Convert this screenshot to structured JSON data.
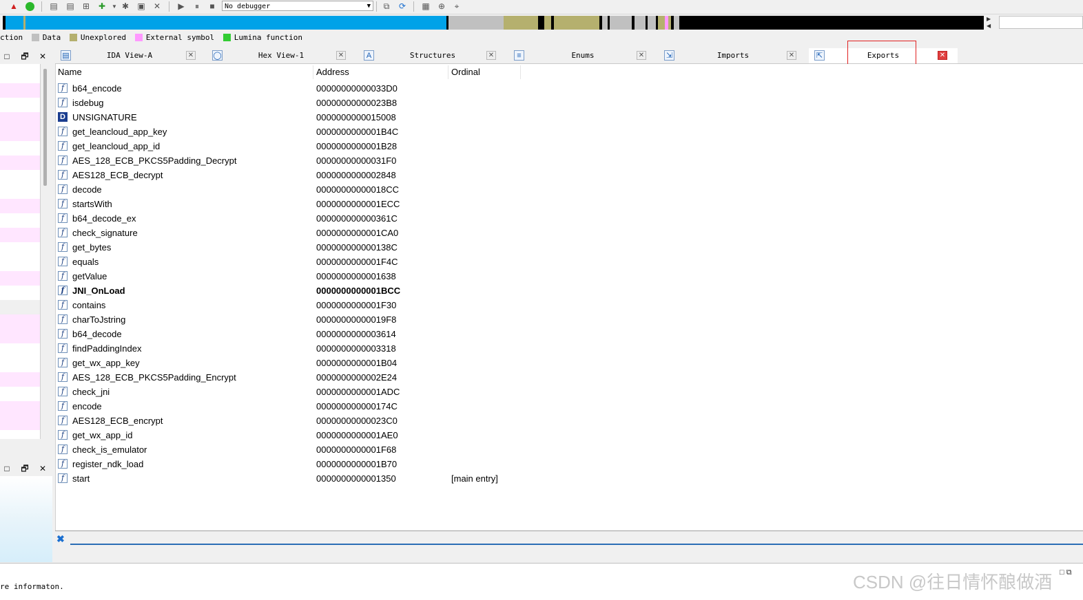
{
  "toolbar": {
    "debugger_select": "No debugger",
    "icons": [
      "warning-icon",
      "run-icon",
      "segment-icon",
      "segment2-icon",
      "add-icon",
      "plus-green-icon",
      "dropdown-icon",
      "settings-icon",
      "image-icon",
      "close-x-icon",
      "play-icon",
      "pause-icon",
      "stop-icon",
      "debug1-icon",
      "debug2-icon",
      "script-icon",
      "patch-icon",
      "cursor-icon"
    ]
  },
  "navband": {
    "colors": {
      "code": "#00a2e8",
      "data": "#c0c0c0",
      "unexplored": "#b5b06e",
      "black": "#000000",
      "external": "#ff99ff"
    }
  },
  "legend": {
    "items": [
      {
        "label": "ction",
        "color": ""
      },
      {
        "label": "Data",
        "color": "#c0c0c0"
      },
      {
        "label": "Unexplored",
        "color": "#b5b06e"
      },
      {
        "label": "External symbol",
        "color": "#ff99ff"
      },
      {
        "label": "Lumina function",
        "color": "#33cc33"
      }
    ]
  },
  "tabs": [
    {
      "label": "IDA View-A",
      "icon": "ida-view-icon"
    },
    {
      "label": "Hex View-1",
      "icon": "hex-view-icon"
    },
    {
      "label": "Structures",
      "icon": "structures-icon"
    },
    {
      "label": "Enums",
      "icon": "enums-icon"
    },
    {
      "label": "Imports",
      "icon": "imports-icon"
    },
    {
      "label": "Exports",
      "icon": "exports-icon",
      "active": true
    }
  ],
  "exports": {
    "columns": [
      "Name",
      "Address",
      "Ordinal"
    ],
    "rows": [
      {
        "name": "b64_encode",
        "address": "00000000000033D0",
        "ordinal": "",
        "type": "f"
      },
      {
        "name": "isdebug",
        "address": "00000000000023B8",
        "ordinal": "",
        "type": "f"
      },
      {
        "name": "UNSIGNATURE",
        "address": "0000000000015008",
        "ordinal": "",
        "type": "D"
      },
      {
        "name": "get_leancloud_app_key",
        "address": "0000000000001B4C",
        "ordinal": "",
        "type": "f"
      },
      {
        "name": "get_leancloud_app_id",
        "address": "0000000000001B28",
        "ordinal": "",
        "type": "f"
      },
      {
        "name": "AES_128_ECB_PKCS5Padding_Decrypt",
        "address": "00000000000031F0",
        "ordinal": "",
        "type": "f"
      },
      {
        "name": "AES128_ECB_decrypt",
        "address": "0000000000002848",
        "ordinal": "",
        "type": "f"
      },
      {
        "name": "decode",
        "address": "00000000000018CC",
        "ordinal": "",
        "type": "f"
      },
      {
        "name": "startsWith",
        "address": "0000000000001ECC",
        "ordinal": "",
        "type": "f"
      },
      {
        "name": "b64_decode_ex",
        "address": "000000000000361C",
        "ordinal": "",
        "type": "f"
      },
      {
        "name": "check_signature",
        "address": "0000000000001CA0",
        "ordinal": "",
        "type": "f"
      },
      {
        "name": "get_bytes",
        "address": "000000000000138C",
        "ordinal": "",
        "type": "f"
      },
      {
        "name": "equals",
        "address": "0000000000001F4C",
        "ordinal": "",
        "type": "f"
      },
      {
        "name": "getValue",
        "address": "0000000000001638",
        "ordinal": "",
        "type": "f"
      },
      {
        "name": "JNI_OnLoad",
        "address": "0000000000001BCC",
        "ordinal": "",
        "type": "f",
        "bold": true
      },
      {
        "name": "contains",
        "address": "0000000000001F30",
        "ordinal": "",
        "type": "f"
      },
      {
        "name": "charToJstring",
        "address": "00000000000019F8",
        "ordinal": "",
        "type": "f"
      },
      {
        "name": "b64_decode",
        "address": "0000000000003614",
        "ordinal": "",
        "type": "f"
      },
      {
        "name": "findPaddingIndex",
        "address": "0000000000003318",
        "ordinal": "",
        "type": "f"
      },
      {
        "name": "get_wx_app_key",
        "address": "0000000000001B04",
        "ordinal": "",
        "type": "f"
      },
      {
        "name": "AES_128_ECB_PKCS5Padding_Encrypt",
        "address": "0000000000002E24",
        "ordinal": "",
        "type": "f"
      },
      {
        "name": "check_jni",
        "address": "0000000000001ADC",
        "ordinal": "",
        "type": "f"
      },
      {
        "name": "encode",
        "address": "000000000000174C",
        "ordinal": "",
        "type": "f"
      },
      {
        "name": "AES128_ECB_encrypt",
        "address": "00000000000023C0",
        "ordinal": "",
        "type": "f"
      },
      {
        "name": "get_wx_app_id",
        "address": "0000000000001AE0",
        "ordinal": "",
        "type": "f"
      },
      {
        "name": "check_is_emulator",
        "address": "0000000000001F68",
        "ordinal": "",
        "type": "f"
      },
      {
        "name": "register_ndk_load",
        "address": "0000000000001B70",
        "ordinal": "",
        "type": "f"
      },
      {
        "name": "start",
        "address": "0000000000001350",
        "ordinal": "[main entry]",
        "type": "f"
      }
    ]
  },
  "status": {
    "text": "re informaton."
  },
  "watermark": "CSDN @往日情怀酿做酒"
}
